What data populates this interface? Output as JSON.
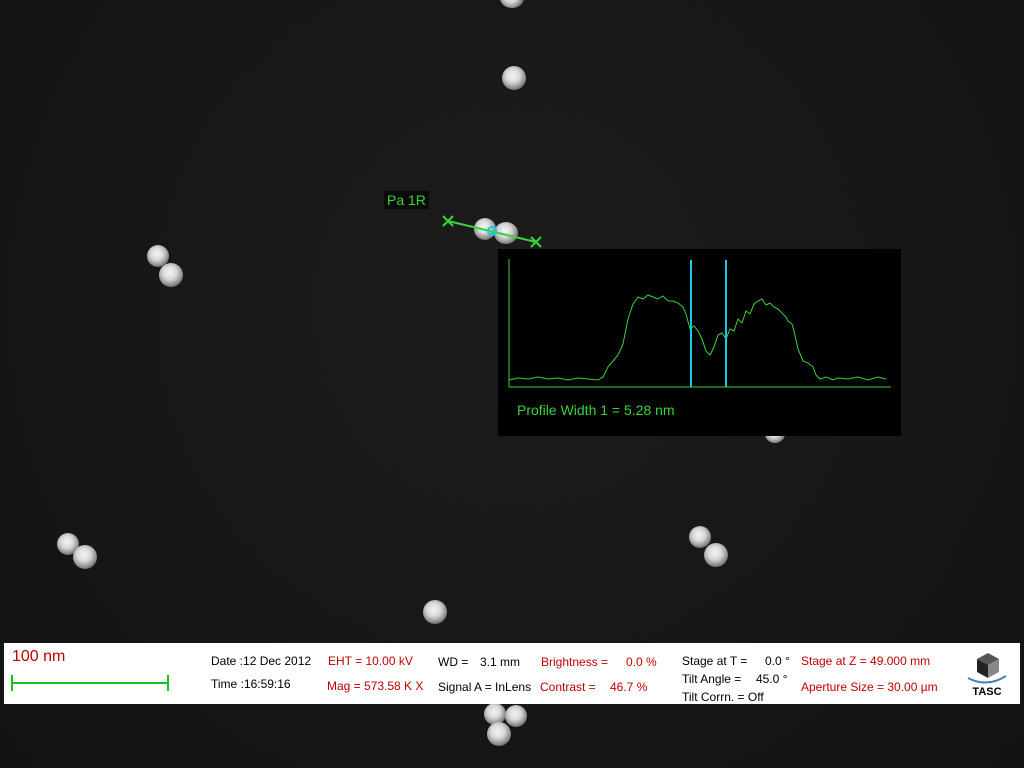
{
  "image": {
    "subject": "SEM micrograph of nanoparticles with line profile measurement",
    "colors": {
      "background": "#161616",
      "measure": "#39d339",
      "cursor": "#19c9e6",
      "databar_value": "#c00000"
    }
  },
  "measurement": {
    "label": "Pa 1R",
    "profile_text": "Profile Width 1 = 5.28 nm"
  },
  "scale_bar": {
    "label": "100 nm"
  },
  "databar": {
    "date": "Date :12 Dec 2012",
    "time": "Time :16:59:16",
    "eht": "EHT = 10.00 kV",
    "mag": "Mag = 573.58 K X",
    "wd_label": "WD =",
    "wd_value": "3.1 mm",
    "signal": "Signal A = InLens",
    "brightness_label": "Brightness =",
    "brightness_value": "0.0 %",
    "contrast_label": "Contrast =",
    "contrast_value": "46.7 %",
    "stage_t_label": "Stage at T =",
    "stage_t_value": "0.0 °",
    "tilt_angle_label": "Tilt Angle =",
    "tilt_angle_value": "45.0 °",
    "tilt_corrn": "Tilt Corrn. = Off",
    "stage_z": "Stage at Z = 49.000 mm",
    "aperture": "Aperture Size = 30.00 µm",
    "logo_text": "TASC",
    "logo_icon": "tasc-cube-logo-icon"
  }
}
